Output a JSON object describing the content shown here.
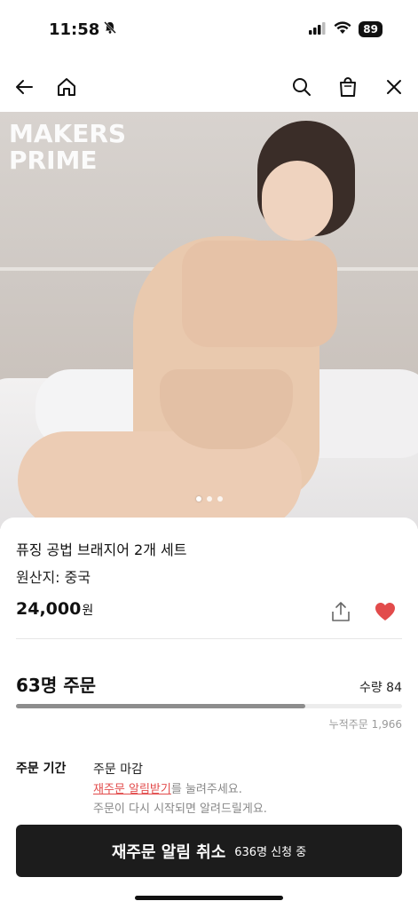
{
  "status_bar": {
    "time": "11:58",
    "battery": "89",
    "icons": [
      "bell-slash-icon",
      "signal-icon",
      "wifi-icon",
      "battery-icon"
    ]
  },
  "nav": {
    "icons": [
      "back-arrow-icon",
      "home-icon",
      "search-icon",
      "shopping-bag-icon",
      "close-icon"
    ]
  },
  "hero": {
    "brand_logo": "MAKERS PRIME",
    "carousel_total": 3,
    "carousel_active": 1
  },
  "product": {
    "name": "퓨징 공법 브래지어 2개 세트",
    "origin": "원산지: 중국",
    "price": "24,000",
    "price_unit": "원",
    "liked": true
  },
  "order": {
    "count_label": "63명 주문",
    "quantity_label": "수량 84",
    "progress": 0.75,
    "cumulative_label": "누적주문 1,966"
  },
  "period": {
    "label": "주문 기간",
    "title": "주문 마감",
    "link_text": "재주문 알림받기",
    "line1_suffix": "를 눌려주세요.",
    "line2": "주문이 다시 시작되면 알려드릴게요."
  },
  "cta": {
    "main": "재주문 알림 취소",
    "sub": "636명 신청 중"
  },
  "colors": {
    "accent_red": "#e24b4b",
    "cta_bg": "#1c1c1c"
  }
}
